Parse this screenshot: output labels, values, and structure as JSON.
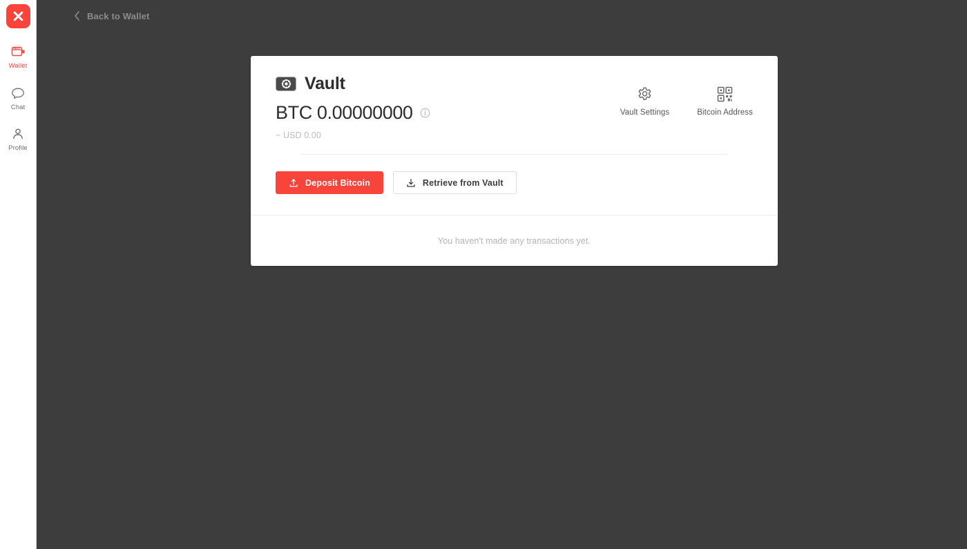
{
  "sidebar": {
    "logo": {
      "icon": "x-logo-icon",
      "label": "X",
      "color": "#f8443b"
    },
    "items": [
      {
        "label": "Wallet",
        "icon": "wallet-icon",
        "active": true
      },
      {
        "label": "Chat",
        "icon": "chat-bubble-icon",
        "active": false
      },
      {
        "label": "Profile",
        "icon": "person-icon",
        "active": false
      }
    ]
  },
  "header": {
    "back_label": "Back to Wallet",
    "back_icon": "chevron-left-icon"
  },
  "vault": {
    "title": "Vault",
    "badge_icon": "vault-dial-icon",
    "btc_balance": "BTC 0.00000000",
    "info_icon": "info-circle-icon",
    "usd_balance": "~ USD 0.00"
  },
  "quick_actions": [
    {
      "label": "Vault Settings",
      "icon": "gear-icon"
    },
    {
      "label": "Bitcoin Address",
      "icon": "qr-code-icon"
    }
  ],
  "buttons": {
    "deposit": {
      "label": "Deposit Bitcoin",
      "icon": "upload-icon",
      "color": "#f8443b"
    },
    "retrieve": {
      "label": "Retrieve from Vault",
      "icon": "download-icon"
    }
  },
  "transactions": {
    "empty_message": "You haven't made any transactions yet."
  },
  "colors": {
    "background": "#3d3d3d",
    "card": "#ffffff",
    "accent": "#f8443b",
    "muted_text": "#b4b4b4"
  }
}
